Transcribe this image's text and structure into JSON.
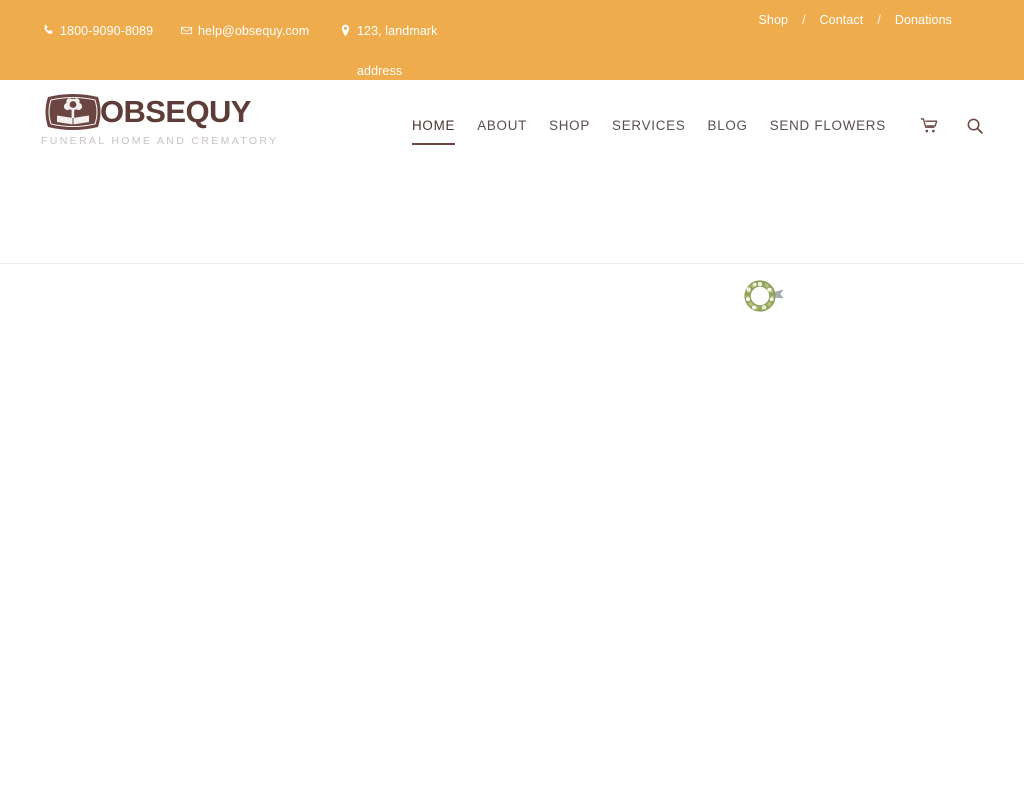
{
  "topbar": {
    "background_color": "#efac4c",
    "contacts": [
      {
        "icon": "phone-icon",
        "text": "1800-9090-8089"
      },
      {
        "icon": "envelope-icon",
        "text": "help@obsequy.com"
      },
      {
        "icon": "map-pin-icon",
        "text": "123, landmark address"
      }
    ],
    "links": [
      {
        "label": "Shop"
      },
      {
        "label": "Contact"
      },
      {
        "label": "Donations"
      }
    ],
    "separator": "/"
  },
  "header": {
    "logo": {
      "word": "OBSEQUY",
      "tagline": "FUNERAL HOME AND CREMATORY",
      "emblem_icon": "tree-and-book-emblem-icon",
      "word_color": "#5e3c38",
      "tagline_color": "#c9c3c2"
    },
    "nav": [
      {
        "label": "HOME",
        "active": true
      },
      {
        "label": "ABOUT",
        "active": false
      },
      {
        "label": "SHOP",
        "active": false
      },
      {
        "label": "SERVICES",
        "active": false
      },
      {
        "label": "BLOG",
        "active": false
      },
      {
        "label": "SEND FLOWERS",
        "active": false
      }
    ],
    "icons": [
      {
        "name": "cart-icon"
      },
      {
        "name": "search-icon"
      }
    ],
    "accent_color": "#6b4541"
  },
  "hero": {
    "preloader_icon": "floral-wreath-preloader-icon"
  }
}
